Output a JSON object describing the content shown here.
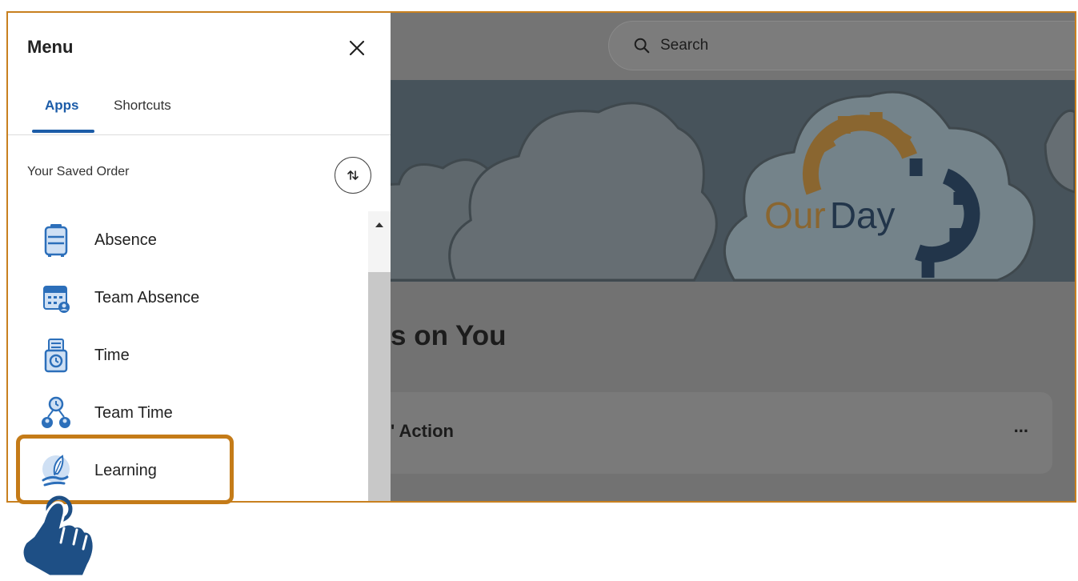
{
  "menu": {
    "title": "Menu",
    "tabs": [
      {
        "label": "Apps",
        "active": true
      },
      {
        "label": "Shortcuts",
        "active": false
      }
    ],
    "saved_order_label": "Your Saved Order",
    "items": [
      {
        "label": "Absence",
        "icon": "suitcase-icon"
      },
      {
        "label": "Team Absence",
        "icon": "calendar-person-icon"
      },
      {
        "label": "Time",
        "icon": "time-clock-icon"
      },
      {
        "label": "Team Time",
        "icon": "team-clock-icon"
      },
      {
        "label": "Learning",
        "icon": "hand-feather-icon"
      }
    ]
  },
  "search": {
    "placeholder": "Search"
  },
  "banner": {
    "logo_text_a": "Our",
    "logo_text_b": "Day"
  },
  "main": {
    "section_title": "s on You",
    "card_label": "' Action",
    "card_more": "..."
  },
  "colors": {
    "accent": "#1c5ca8",
    "highlight": "#c47b18",
    "logo_orange": "#d98a20",
    "logo_blue": "#1e4f85"
  }
}
